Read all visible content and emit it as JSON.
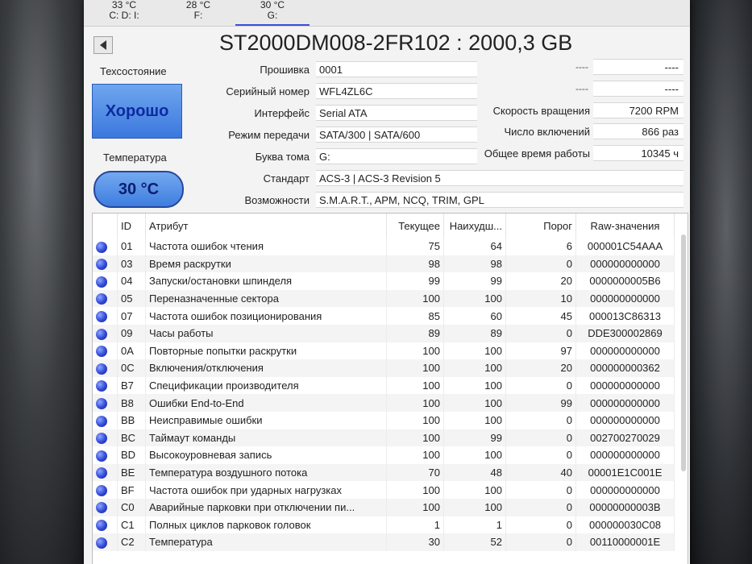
{
  "drive_tabs": [
    {
      "temp": "33 °C",
      "letter": "C: D: I:"
    },
    {
      "temp": "28 °C",
      "letter": "F:"
    },
    {
      "temp": "30 °C",
      "letter": "G:"
    }
  ],
  "disk_title": "ST2000DM008-2FR102 : 2000,3 GB",
  "health": {
    "label": "Техсостояние",
    "value": "Хорошо"
  },
  "temperature": {
    "label": "Температура",
    "value": "30 °C"
  },
  "info": {
    "firmware": {
      "label": "Прошивка",
      "value": "0001"
    },
    "serial": {
      "label": "Серийный номер",
      "value": "WFL4ZL6C"
    },
    "interface": {
      "label": "Интерфейс",
      "value": "Serial ATA"
    },
    "transfer_mode": {
      "label": "Режим передачи",
      "value": "SATA/300 | SATA/600"
    },
    "drive_letter": {
      "label": "Буква тома",
      "value": "G:"
    },
    "standard": {
      "label": "Стандарт",
      "value": "ACS-3 | ACS-3 Revision 5"
    },
    "features": {
      "label": "Возможности",
      "value": "S.M.A.R.T., APM, NCQ, TRIM, GPL"
    },
    "rotation": {
      "label": "Скорость вращения",
      "value": "7200 RPM"
    },
    "power_on_count": {
      "label": "Число включений",
      "value": "866 раз"
    },
    "power_on_hours": {
      "label": "Общее время работы",
      "value": "10345 ч"
    },
    "dash_label_1": "----",
    "dash_value_1": "----",
    "dash_label_2": "----",
    "dash_value_2": "----"
  },
  "smart_table": {
    "headers": {
      "id": "ID",
      "attribute": "Атрибут",
      "current": "Текущее",
      "worst": "Наихудш...",
      "threshold": "Порог",
      "raw": "Raw-значения"
    },
    "rows": [
      {
        "id": "01",
        "name": "Частота ошибок чтения",
        "cur": "75",
        "worst": "64",
        "thr": "6",
        "raw": "000001C54AAA"
      },
      {
        "id": "03",
        "name": "Время раскрутки",
        "cur": "98",
        "worst": "98",
        "thr": "0",
        "raw": "000000000000"
      },
      {
        "id": "04",
        "name": "Запуски/остановки шпинделя",
        "cur": "99",
        "worst": "99",
        "thr": "20",
        "raw": "0000000005B6"
      },
      {
        "id": "05",
        "name": "Переназначенные сектора",
        "cur": "100",
        "worst": "100",
        "thr": "10",
        "raw": "000000000000"
      },
      {
        "id": "07",
        "name": "Частота ошибок позиционирования",
        "cur": "85",
        "worst": "60",
        "thr": "45",
        "raw": "000013C86313"
      },
      {
        "id": "09",
        "name": "Часы работы",
        "cur": "89",
        "worst": "89",
        "thr": "0",
        "raw": "DDE300002869"
      },
      {
        "id": "0A",
        "name": "Повторные попытки раскрутки",
        "cur": "100",
        "worst": "100",
        "thr": "97",
        "raw": "000000000000"
      },
      {
        "id": "0C",
        "name": "Включения/отключения",
        "cur": "100",
        "worst": "100",
        "thr": "20",
        "raw": "000000000362"
      },
      {
        "id": "B7",
        "name": "Спецификации производителя",
        "cur": "100",
        "worst": "100",
        "thr": "0",
        "raw": "000000000000"
      },
      {
        "id": "B8",
        "name": "Ошибки End-to-End",
        "cur": "100",
        "worst": "100",
        "thr": "99",
        "raw": "000000000000"
      },
      {
        "id": "BB",
        "name": "Неисправимые ошибки",
        "cur": "100",
        "worst": "100",
        "thr": "0",
        "raw": "000000000000"
      },
      {
        "id": "BC",
        "name": "Таймаут команды",
        "cur": "100",
        "worst": "99",
        "thr": "0",
        "raw": "002700270029"
      },
      {
        "id": "BD",
        "name": "Высокоуровневая запись",
        "cur": "100",
        "worst": "100",
        "thr": "0",
        "raw": "000000000000"
      },
      {
        "id": "BE",
        "name": "Температура воздушного потока",
        "cur": "70",
        "worst": "48",
        "thr": "40",
        "raw": "00001E1C001E"
      },
      {
        "id": "BF",
        "name": "Частота ошибок при ударных нагрузках",
        "cur": "100",
        "worst": "100",
        "thr": "0",
        "raw": "000000000000"
      },
      {
        "id": "C0",
        "name": "Аварийные парковки при отключении пи...",
        "cur": "100",
        "worst": "100",
        "thr": "0",
        "raw": "00000000003B"
      },
      {
        "id": "C1",
        "name": "Полных циклов парковок головок",
        "cur": "1",
        "worst": "1",
        "thr": "0",
        "raw": "000000030C08"
      },
      {
        "id": "C2",
        "name": "Температура",
        "cur": "30",
        "worst": "52",
        "thr": "0",
        "raw": "00110000001E"
      }
    ]
  },
  "colors": {
    "status_good": "#3a78de",
    "active_tab_underline": "#3b4fd8"
  }
}
